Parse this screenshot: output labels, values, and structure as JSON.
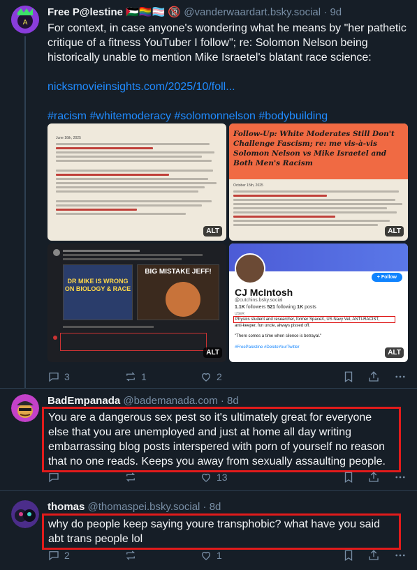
{
  "posts": [
    {
      "author": "Free P@lestine 🇵🇸🏳️‍🌈🏳️‍⚧️ 🔞",
      "handle": "@vanderwaardart.bsky.social",
      "time": "9d",
      "text": "For context, in case anyone's wondering what he means by \"her pathetic critique of a fitness YouTuber I follow\"; re: Solomon Nelson being historically unable to mention Mike Israetel's blatant race science:",
      "link": "nicksmovieinsights.com/2025/10/foll...",
      "hashtags": "#racism #whitemoderacy #solomonnelson #bodybuilding",
      "images": {
        "img1_date": "June 16th, 2025",
        "img2_title": "Follow-Up: White Moderates Still Don't Challenge Fascism; re: me vis-à-vis Solomon Nelson vs Mike Israetel and Both Men's Racism",
        "img2_date": "October 15th, 2025",
        "img3_thumb_left": "DR MIKE IS WRONG ON BIOLOGY & RACE",
        "img3_thumb_right": "BIG MISTAKE JEFF!",
        "img4_name": "CJ McIntosh",
        "img4_handle": "@cutchins.bsky.social",
        "img4_followers": "1.1K",
        "img4_followers_label": "followers",
        "img4_following": "521",
        "img4_following_label": "following",
        "img4_posts": "1K",
        "img4_posts_label": "posts",
        "img4_follow": "+ Follow",
        "img4_bio_tag": "USER",
        "img4_bio": "Physics student and researcher, former SpaceX, US Navy Vet, ANTI-RACIST,",
        "img4_bio2": "anti-keeper, fun uncle, always pissed off.",
        "img4_quote": "\"There comes a time when silence is betrayal.\"",
        "img4_tags": "#FreePalestine #DeleteYourTwitter",
        "alt": "ALT"
      },
      "replies": "3",
      "reposts": "1",
      "likes": "2"
    },
    {
      "author": "BadEmpanada",
      "handle": "@bademanada.com",
      "time": "8d",
      "text": "You are a dangerous sex pest so it's ultimately great for everyone else that you are unemployed and just at home all day writing embarrassing blog posts interspered with porn of yourself no reason that no one reads. Keeps you away from sexually assaulting people.",
      "replies": "",
      "reposts": "",
      "likes": "13"
    },
    {
      "author": "thomas",
      "handle": "@thomaspei.bsky.social",
      "time": "8d",
      "text": "why do people keep saying youre transphobic? what have you said abt trans people lol",
      "replies": "2",
      "reposts": "",
      "likes": "1"
    }
  ],
  "dot": "·",
  "colors": {
    "background": "#161e27",
    "accent": "#208bfe",
    "muted": "#788ea5",
    "highlight": "#e21b1b"
  },
  "icons": [
    "reply-icon",
    "repost-icon",
    "like-icon",
    "bookmark-icon",
    "share-icon",
    "more-icon"
  ]
}
